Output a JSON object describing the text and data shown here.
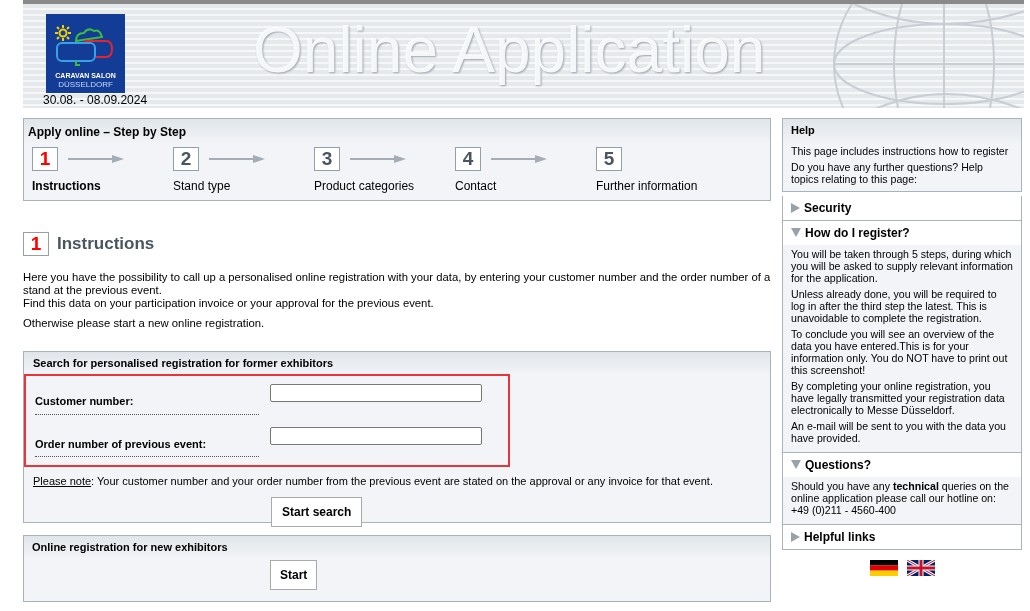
{
  "header": {
    "logo_line1": "CARAVAN SALON",
    "logo_line2": "DÜSSELDORF",
    "dates": "30.08. - 08.09.2024",
    "title": "Online Application"
  },
  "steps_panel": {
    "title": "Apply online – Step by Step",
    "steps": [
      {
        "number": "1",
        "label": "Instructions",
        "selected": true
      },
      {
        "number": "2",
        "label": "Stand type",
        "selected": false
      },
      {
        "number": "3",
        "label": "Product categories",
        "selected": false
      },
      {
        "number": "4",
        "label": "Contact",
        "selected": false
      },
      {
        "number": "5",
        "label": "Further information",
        "selected": false
      }
    ]
  },
  "section": {
    "number": "1",
    "title": "Instructions",
    "paragraphs": [
      "Here you have the possibility to call up a personalised online registration with your data, by entering your customer number and the order number of a stand at the previous event.\nFind this data on your participation invoice or your approval for the previous event.",
      "Otherwise please start a new online registration."
    ]
  },
  "search_panel": {
    "title": "Search for personalised registration for former exhibitors",
    "highlighted": true,
    "fields": [
      {
        "label": "Customer number:"
      },
      {
        "label": "Order number of previous event:"
      }
    ],
    "note_link": "Please note",
    "note_text": ": Your customer number and your order number from the previous event are stated on the approval or any invoice for that event.",
    "button": "Start search"
  },
  "new_panel": {
    "title": "Online registration for new exhibitors",
    "button": "Start"
  },
  "help": {
    "title": "Help",
    "paragraphs": [
      "This page includes instructions how to register",
      "Do you have any further questions? Help topics relating to this page:"
    ],
    "topics": [
      {
        "title": "Security",
        "expanded": false
      },
      {
        "title": "How do I register?",
        "expanded": true,
        "paragraphs": [
          "You will be taken through 5 steps, during which you will be asked to supply relevant information for the application.",
          "Unless already done, you will be required to log in after the third step the latest. This is unavoidable to complete the registration.",
          "To conclude you will see an overview of the data you have entered.This is for your information only. You do NOT have to print out this screenshot!",
          "By completing your online registration, you have legally transmitted your registration data electronically to Messe Düsseldorf.",
          "An e-mail will be sent to you with the data you have provided."
        ]
      },
      {
        "title": "Questions?",
        "expanded": true,
        "paragraphs": [
          "Should you have any **technical** queries on the online application please call our hotline on:\n+49 (0)211 - 4560-400"
        ]
      },
      {
        "title": "Helpful links",
        "expanded": false
      }
    ]
  },
  "languages": [
    {
      "kind": "de"
    },
    {
      "kind": "uk"
    }
  ]
}
